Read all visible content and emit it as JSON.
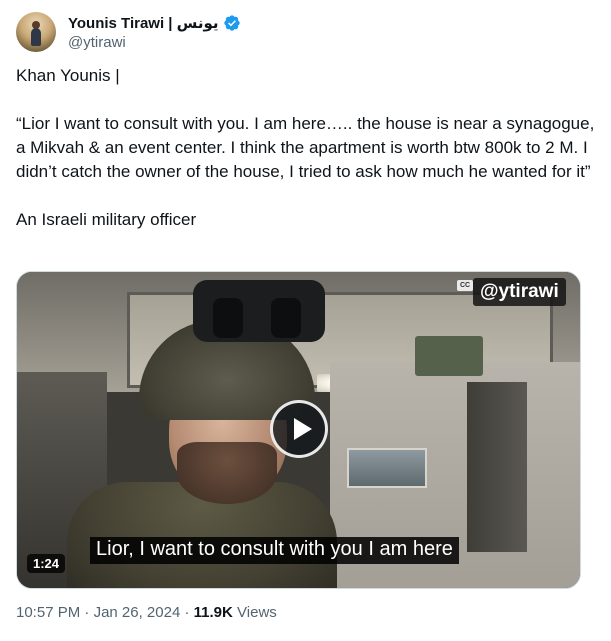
{
  "author": {
    "display_name": "Younis Tirawi | يونس",
    "handle": "@ytirawi",
    "verified_icon": "verified-badge-icon",
    "verified_color": "#1d9bf0"
  },
  "tweet": {
    "line1": "Khan Younis |",
    "quote": "“Lior I want to consult with you. I am here….. the house is near a synagogue, a Mikvah & an event center. I think the apartment is worth btw 800k to 2 M. I didn’t catch the owner of the house, I tried to ask how much he wanted for it”",
    "line3": "An Israeli military officer"
  },
  "media": {
    "watermark": "@ytirawi",
    "cc_label": "CC",
    "subtitle": "Lior, I want to consult with you I am here",
    "duration": "1:24",
    "play_icon": "play-icon"
  },
  "meta": {
    "time": "10:57 PM",
    "separator": "·",
    "date": "Jan 26, 2024",
    "views_count": "11.9K",
    "views_label": "Views"
  }
}
